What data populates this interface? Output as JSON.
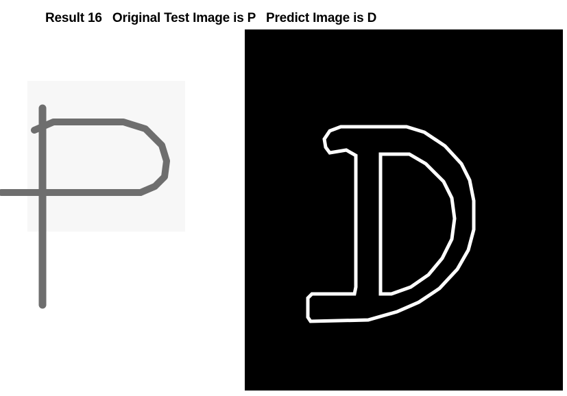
{
  "figure": {
    "title": "Result 16   Original Test Image is P   Predict Image is D"
  },
  "original_image": {
    "depicted_character": "P",
    "stroke_color": "#6e6e6e",
    "background_color": "#ffffff"
  },
  "predicted_image": {
    "depicted_character": "D",
    "edge_color": "#ffffff",
    "background_color": "#000000"
  }
}
